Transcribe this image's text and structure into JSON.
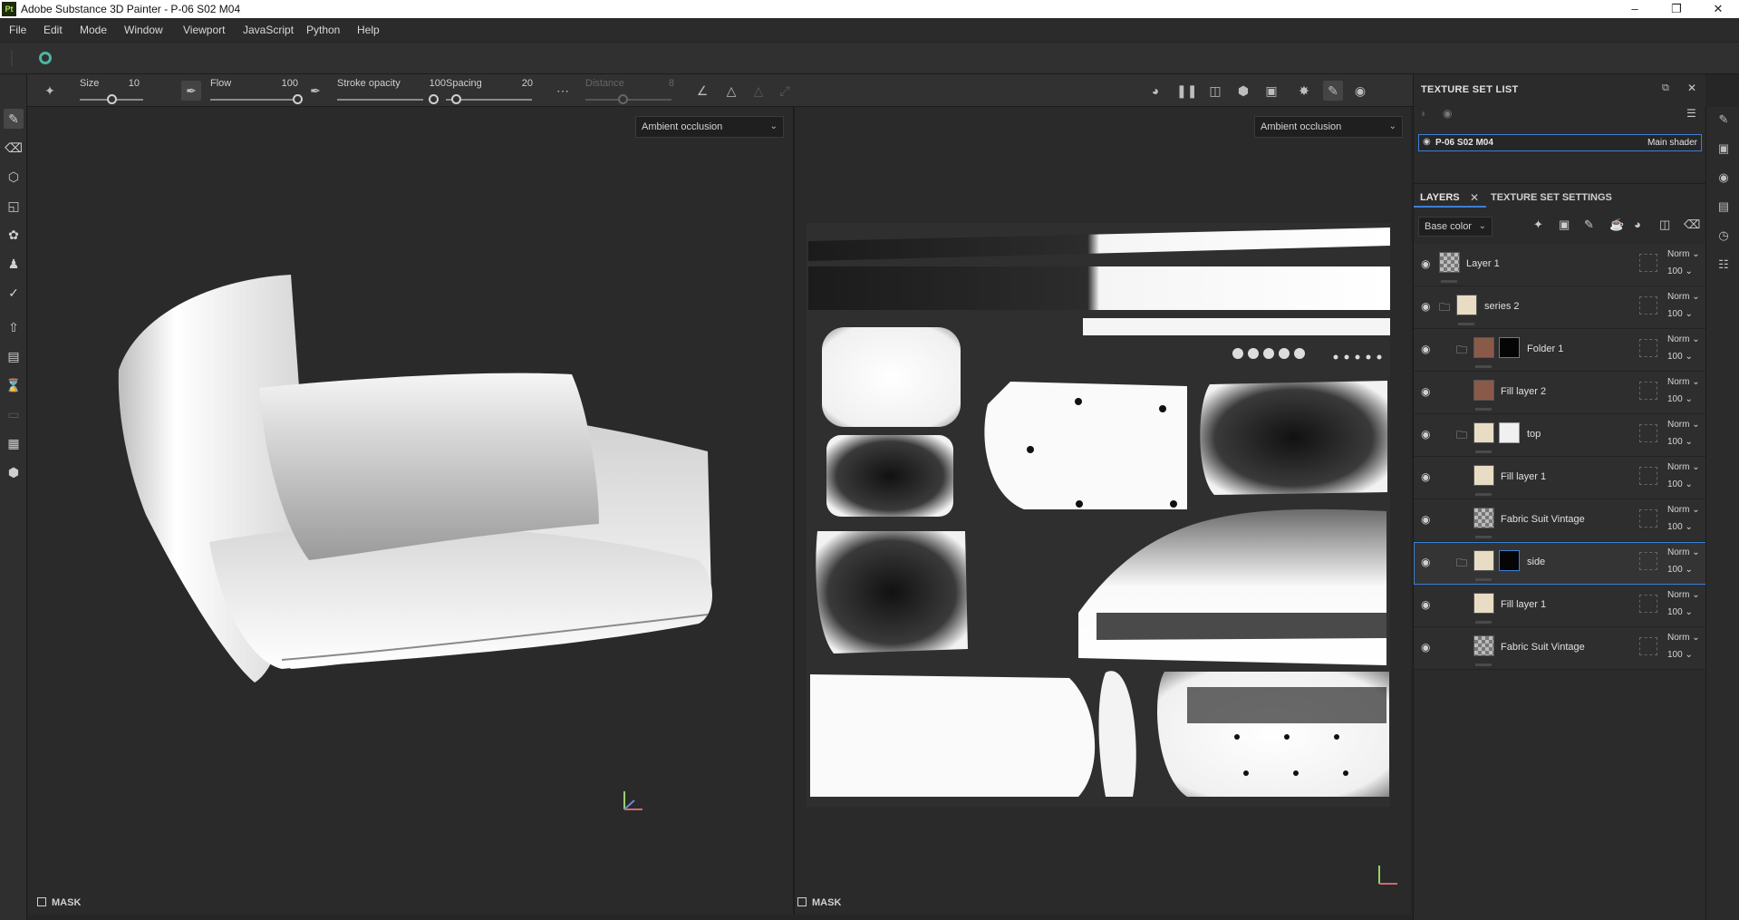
{
  "window": {
    "app_icon": "Pt",
    "title": "Adobe Substance 3D Painter - P-06 S02 M04",
    "controls": [
      "minimize-icon",
      "maximize-icon",
      "close-icon"
    ]
  },
  "menu": [
    "File",
    "Edit",
    "Mode",
    "Window",
    "Viewport",
    "JavaScript",
    "Python",
    "Help"
  ],
  "tool_options": {
    "size_label": "Size",
    "size_value": "10",
    "flow_label": "Flow",
    "flow_value": "100",
    "stroke_opacity_label": "Stroke opacity",
    "stroke_opacity_value": "100",
    "spacing_label": "Spacing",
    "spacing_value": "20",
    "distance_label": "Distance",
    "distance_value": "8"
  },
  "viewport_3d": {
    "mode": "Ambient occlusion",
    "mask_label": "MASK"
  },
  "viewport_2d": {
    "mode": "Ambient occlusion",
    "mask_label": "MASK"
  },
  "texture_set_list": {
    "title": "TEXTURE SET LIST",
    "set_name": "P-06 S02 M04",
    "shader": "Main shader"
  },
  "layers_panel": {
    "tab_layers": "LAYERS",
    "tab_settings": "TEXTURE SET SETTINGS",
    "channel": "Base color",
    "layers": [
      {
        "name": "Layer 1",
        "blend": "Norm",
        "opacity": "100"
      },
      {
        "name": "series 2",
        "blend": "Norm",
        "opacity": "100"
      },
      {
        "name": "Folder 1",
        "blend": "Norm",
        "opacity": "100"
      },
      {
        "name": "Fill layer 2",
        "blend": "Norm",
        "opacity": "100"
      },
      {
        "name": "top",
        "blend": "Norm",
        "opacity": "100"
      },
      {
        "name": "Fill layer 1",
        "blend": "Norm",
        "opacity": "100"
      },
      {
        "name": "Fabric Suit Vintage",
        "blend": "Norm",
        "opacity": "100"
      },
      {
        "name": "side",
        "blend": "Norm",
        "opacity": "100"
      },
      {
        "name": "Fill layer 1",
        "blend": "Norm",
        "opacity": "100"
      },
      {
        "name": "Fabric Suit Vintage",
        "blend": "Norm",
        "opacity": "100"
      }
    ]
  },
  "colors": {
    "accent": "#3d7fd6",
    "cream": "#e8dcc4",
    "brown": "#8a5a48"
  }
}
